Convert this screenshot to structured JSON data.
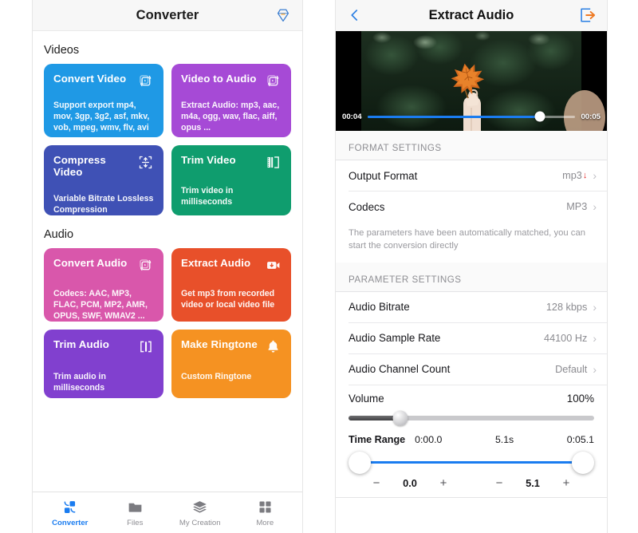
{
  "left": {
    "header": {
      "title": "Converter",
      "pro_icon": "pro-diamond-icon"
    },
    "sections": [
      {
        "title": "Videos",
        "rows": [
          [
            {
              "title": "Convert Video",
              "desc": "Support export mp4, mov, 3gp, 3g2, asf, mkv, vob, mpeg, wmv, flv, avi ...",
              "color": "#1f99e5",
              "icon": "convert-icon"
            },
            {
              "title": "Video to Audio",
              "desc": "Extract Audio: mp3, aac, m4a, ogg, wav, flac, aiff, opus ...",
              "color": "#a64ad6",
              "icon": "convert-icon"
            }
          ],
          [
            {
              "title": "Compress Video",
              "desc": "Variable Bitrate Lossless Compression",
              "color": "#3f51b5",
              "icon": "compress-icon"
            },
            {
              "title": "Trim Video",
              "desc": "Trim video in milliseconds",
              "color": "#0f9d6e",
              "icon": "film-trim-icon"
            }
          ]
        ]
      },
      {
        "title": "Audio",
        "rows": [
          [
            {
              "title": "Convert Audio",
              "desc": "Codecs: AAC, MP3, FLAC, PCM, MP2, AMR, OPUS, SWF, WMAV2 ...",
              "color": "#d957ab",
              "icon": "convert-icon"
            },
            {
              "title": "Extract Audio",
              "desc": "Get mp3 from recorded video or local video file",
              "color": "#e8502a",
              "icon": "video-download-icon"
            }
          ],
          [
            {
              "title": "Trim Audio",
              "desc": "Trim audio in milliseconds",
              "color": "#8140cf",
              "icon": "trim-brackets-icon"
            },
            {
              "title": "Make Ringtone",
              "desc": "Custom Ringtone",
              "color": "#f59222",
              "icon": "bell-icon"
            }
          ]
        ]
      }
    ],
    "tabs": [
      {
        "label": "Converter",
        "icon": "converter-icon",
        "active": true
      },
      {
        "label": "Files",
        "icon": "folder-icon",
        "active": false
      },
      {
        "label": "My Creation",
        "icon": "layers-icon",
        "active": false
      },
      {
        "label": "More",
        "icon": "grid-icon",
        "active": false
      }
    ]
  },
  "right": {
    "header": {
      "title": "Extract Audio",
      "back_icon": "back-chevron-icon",
      "export_icon": "export-arrow-icon"
    },
    "player": {
      "current_time": "00:04",
      "total_time": "00:05",
      "progress_percent": 83
    },
    "format_settings": {
      "header": "FORMAT SETTINGS",
      "rows": [
        {
          "label": "Output Format",
          "value": "mp3",
          "has_download_mark": true
        },
        {
          "label": "Codecs",
          "value": "MP3",
          "has_download_mark": false
        }
      ],
      "hint": "The parameters have been automatically matched, you can start the conversion directly"
    },
    "parameter_settings": {
      "header": "PARAMETER SETTINGS",
      "rows": [
        {
          "label": "Audio Bitrate",
          "value": "128 kbps"
        },
        {
          "label": "Audio Sample Rate",
          "value": "44100 Hz"
        },
        {
          "label": "Audio Channel Count",
          "value": "Default"
        }
      ],
      "volume": {
        "label": "Volume",
        "value": "100%",
        "knob_percent": 21
      },
      "time_range": {
        "label": "Time Range",
        "start": "0:00.0",
        "duration": "5.1s",
        "end": "0:05.1",
        "start_stepper": {
          "minus": "−",
          "value": "0.0",
          "plus": "+"
        },
        "end_stepper": {
          "minus": "−",
          "value": "5.1",
          "plus": "+"
        }
      }
    }
  },
  "colors": {
    "accent_blue": "#1a7cf0",
    "red_mark": "#e02020",
    "muted": "#8d8d92"
  }
}
